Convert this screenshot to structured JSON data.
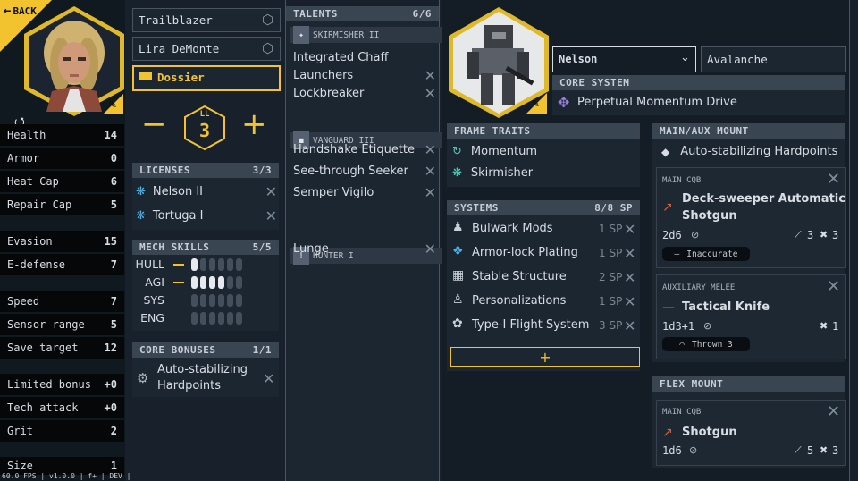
{
  "back_label": "BACK",
  "status_bar": "60.0 FPS | v1.0.0 | f+ | DEV | (0, 0)",
  "stats": [
    {
      "label": "Health",
      "value": "14"
    },
    {
      "label": "Armor",
      "value": "0"
    },
    {
      "label": "Heat Cap",
      "value": "6"
    },
    {
      "label": "Repair Cap",
      "value": "5"
    },
    {
      "label": "Evasion",
      "value": "15"
    },
    {
      "label": "E-defense",
      "value": "7"
    },
    {
      "label": "Speed",
      "value": "7"
    },
    {
      "label": "Sensor range",
      "value": "5"
    },
    {
      "label": "Save target",
      "value": "12"
    },
    {
      "label": "Limited bonus",
      "value": "+0"
    },
    {
      "label": "Tech attack",
      "value": "+0"
    },
    {
      "label": "Grit",
      "value": "2"
    },
    {
      "label": "Size",
      "value": "1"
    }
  ],
  "pilot": {
    "callsign": "Trailblazer",
    "name": "Lira DeMonte",
    "dossier_label": "Dossier",
    "ll_label": "LL",
    "ll_value": "3"
  },
  "licenses": {
    "title": "LICENSES",
    "count": "3/3",
    "items": [
      "Nelson II",
      "Tortuga I"
    ]
  },
  "mech_skills": {
    "title": "MECH SKILLS",
    "count": "5/5",
    "skills": [
      {
        "name": "HULL",
        "level": 1
      },
      {
        "name": "AGI",
        "level": 4
      },
      {
        "name": "SYS",
        "level": 0
      },
      {
        "name": "ENG",
        "level": 0
      }
    ]
  },
  "core_bonuses": {
    "title": "CORE BONUSES",
    "count": "1/1",
    "item_line1": "Auto-stabilizing",
    "item_line2": "Hardpoints"
  },
  "talents": {
    "title": "TALENTS",
    "count": "6/6",
    "groups": [
      {
        "name": "SKIRMISHER II",
        "items": [
          "Integrated Chaff",
          "Launchers",
          "Lockbreaker"
        ]
      },
      {
        "name": "VANGUARD III",
        "items": [
          "Handshake Etiquette",
          "See-through Seeker",
          "Semper Vigilo"
        ]
      },
      {
        "name": "HUNTER I",
        "items": [
          "Lunge"
        ]
      }
    ]
  },
  "mech": {
    "frame": "Nelson",
    "name": "Avalanche",
    "core_system_title": "CORE SYSTEM",
    "core_system": "Perpetual Momentum Drive"
  },
  "frame_traits": {
    "title": "FRAME TRAITS",
    "items": [
      "Momentum",
      "Skirmisher"
    ]
  },
  "systems": {
    "title": "SYSTEMS",
    "count": "8/8 SP",
    "items": [
      {
        "name": "Bulwark Mods",
        "sp": "1 SP"
      },
      {
        "name": "Armor-lock Plating",
        "sp": "1 SP"
      },
      {
        "name": "Stable Structure",
        "sp": "2 SP"
      },
      {
        "name": "Personalizations",
        "sp": "1 SP"
      },
      {
        "name": "Type-I Flight System",
        "sp": "3 SP"
      }
    ],
    "add_label": "+"
  },
  "main_aux_mount": {
    "title": "MAIN/AUX MOUNT",
    "bonus": "Auto-stabilizing Hardpoints",
    "weapon1": {
      "type": "MAIN CQB",
      "name_line1": "Deck-sweeper Automatic",
      "name_line2": "Shotgun",
      "damage": "2d6",
      "range": "3",
      "threat": "3",
      "tag": "Inaccurate"
    },
    "weapon2": {
      "type": "AUXILIARY MELEE",
      "name": "Tactical Knife",
      "damage": "1d3+1",
      "threat": "1",
      "tag": "Thrown 3"
    }
  },
  "flex_mount": {
    "title": "FLEX MOUNT",
    "weapon": {
      "type": "MAIN CQB",
      "name": "Shotgun",
      "damage": "1d6",
      "range": "5",
      "threat": "3"
    }
  },
  "colors": {
    "accent": "#f2c22f",
    "background": "#17202b",
    "header": "#3a4552",
    "stat_bg": "#050709"
  }
}
